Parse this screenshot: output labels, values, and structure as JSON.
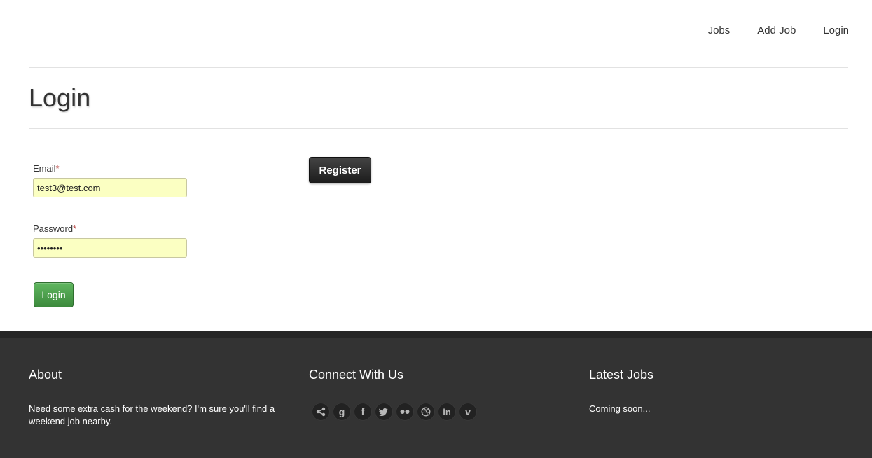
{
  "nav": {
    "items": [
      {
        "label": "Jobs"
      },
      {
        "label": "Add Job"
      },
      {
        "label": "Login"
      }
    ]
  },
  "page": {
    "title": "Login"
  },
  "form": {
    "email_label": "Email",
    "email_value": "test3@test.com",
    "password_label": "Password",
    "password_value": "password",
    "required_mark": "*",
    "submit_label": "Login"
  },
  "register": {
    "label": "Register"
  },
  "footer": {
    "about": {
      "heading": "About",
      "text": "Need some extra cash for the weekend? I'm sure you'll find a weekend job nearby."
    },
    "connect": {
      "heading": "Connect With Us",
      "icons": [
        "share-icon",
        "google-icon",
        "facebook-icon",
        "twitter-icon",
        "flickr-icon",
        "dribbble-icon",
        "linkedin-icon",
        "vimeo-icon"
      ]
    },
    "latest": {
      "heading": "Latest Jobs",
      "text": "Coming soon..."
    }
  },
  "colors": {
    "input_background": "#fbffc2",
    "login_button": "#4a9e4a",
    "register_button": "#2a2a2a",
    "footer_background": "#333333"
  }
}
